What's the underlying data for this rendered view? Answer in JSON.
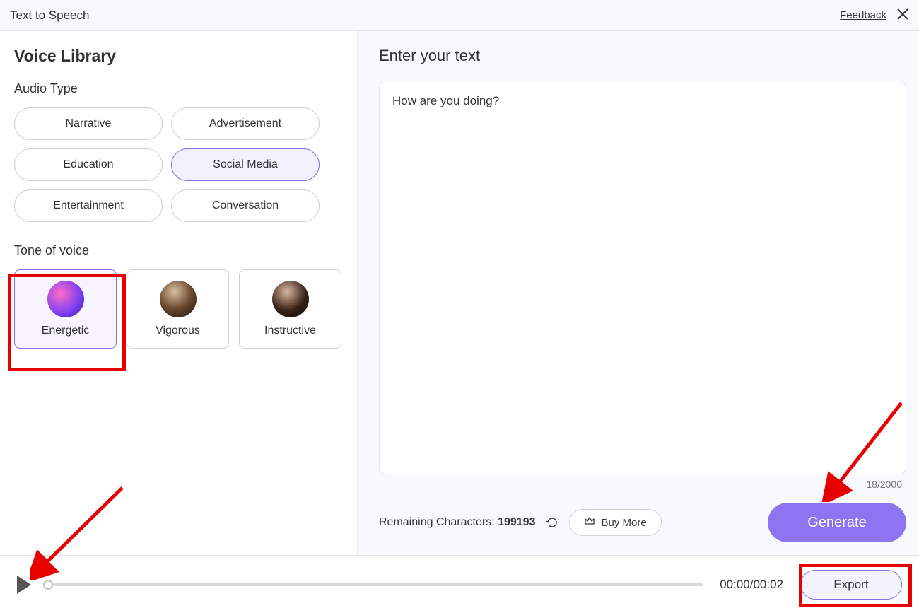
{
  "header": {
    "title": "Text to Speech",
    "feedback": "Feedback"
  },
  "left": {
    "title": "Voice Library",
    "audioTypeLabel": "Audio Type",
    "audioTypes": [
      "Narrative",
      "Advertisement",
      "Education",
      "Social Media",
      "Entertainment",
      "Conversation"
    ],
    "audioTypeSelected": 3,
    "toneLabel": "Tone of voice",
    "tones": [
      "Energetic",
      "Vigorous",
      "Instructive"
    ],
    "toneSelected": 0
  },
  "right": {
    "title": "Enter your text",
    "textValue": "How are you doing?",
    "charCount": "18/2000",
    "remainingLabel": "Remaining Characters: ",
    "remainingValue": "199193",
    "buyMore": "Buy More",
    "generate": "Generate"
  },
  "player": {
    "time": "00:00/00:02",
    "export": "Export"
  }
}
